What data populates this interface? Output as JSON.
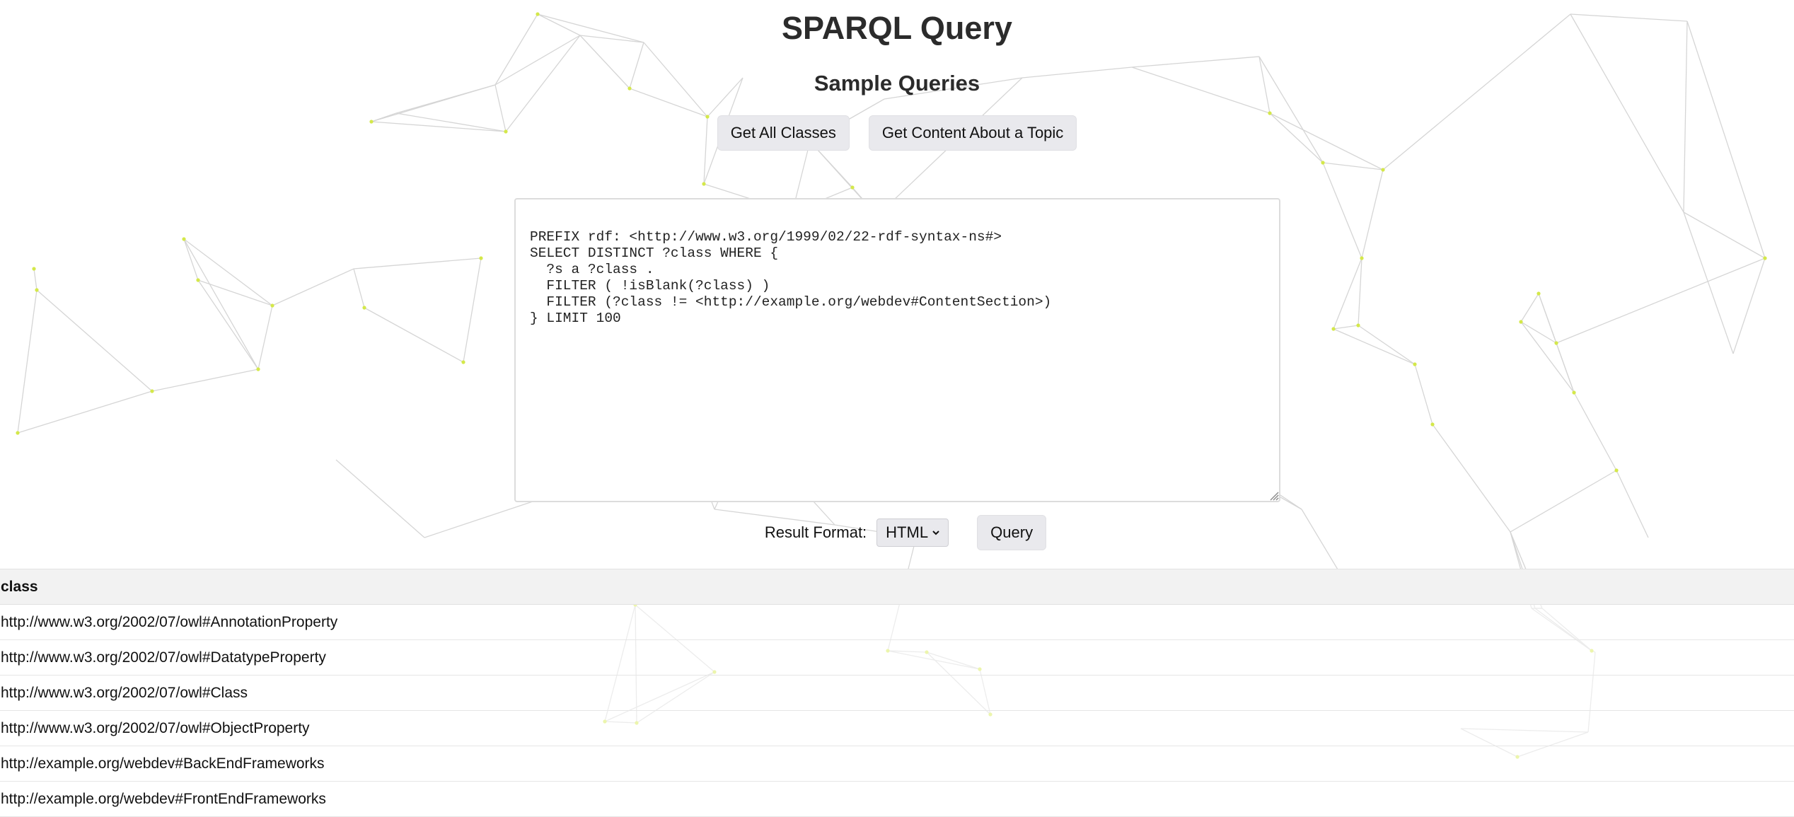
{
  "header": {
    "title": "SPARQL Query",
    "subtitle": "Sample Queries"
  },
  "samples": [
    {
      "label": "Get All Classes"
    },
    {
      "label": "Get Content About a Topic"
    }
  ],
  "editor": {
    "query": "PREFIX rdf: <http://www.w3.org/1999/02/22-rdf-syntax-ns#>\nSELECT DISTINCT ?class WHERE {\n  ?s a ?class .\n  FILTER ( !isBlank(?class) )\n  FILTER (?class != <http://example.org/webdev#ContentSection>)\n} LIMIT 100"
  },
  "controls": {
    "format_label": "Result Format:",
    "format_selected": "HTML",
    "query_button": "Query"
  },
  "results": {
    "columns": [
      "class"
    ],
    "rows": [
      "http://www.w3.org/2002/07/owl#AnnotationProperty",
      "http://www.w3.org/2002/07/owl#DatatypeProperty",
      "http://www.w3.org/2002/07/owl#Class",
      "http://www.w3.org/2002/07/owl#ObjectProperty",
      "http://example.org/webdev#BackEndFrameworks",
      "http://example.org/webdev#FrontEndFrameworks"
    ]
  },
  "colors": {
    "network_line": "#c8c8c8",
    "network_node": "#d4e84a",
    "button_bg": "#e9e9ed",
    "header_row_bg": "#f2f2f2"
  }
}
